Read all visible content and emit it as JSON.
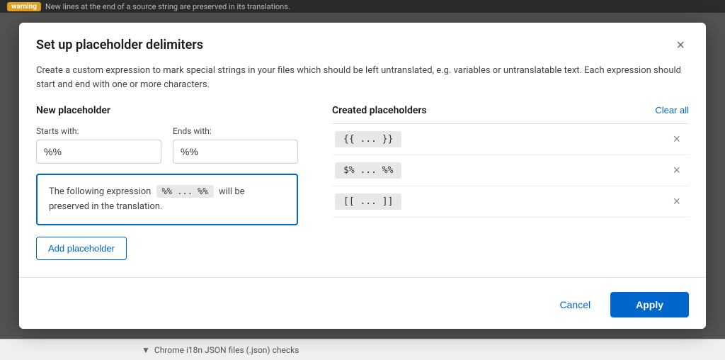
{
  "dialog": {
    "title": "Set up placeholder delimiters",
    "description": "Create a custom expression to mark special strings in your files which should be left untranslated, e.g. variables or untranslatable text. Each expression should start and end with one or more characters.",
    "close_label": "×"
  },
  "left_panel": {
    "section_title": "New placeholder",
    "starts_with_label": "Starts with:",
    "starts_with_value": "%%",
    "ends_with_label": "Ends with:",
    "ends_with_value": "%%",
    "preview_text_before": "The following expression",
    "preview_code": "%% ... %%",
    "preview_text_after": "will be preserved in the translation.",
    "add_button_label": "Add placeholder"
  },
  "right_panel": {
    "section_title": "Created placeholders",
    "clear_all_label": "Clear all",
    "placeholders": [
      {
        "id": 1,
        "tag": "{{ ... }}"
      },
      {
        "id": 2,
        "tag": "$% ... %%"
      },
      {
        "id": 3,
        "tag": "[[ ... ]]"
      }
    ]
  },
  "footer": {
    "cancel_label": "Cancel",
    "apply_label": "Apply"
  },
  "top_bar": {
    "warning_badge": "warning",
    "warning_text": "New lines at the end of a source string are preserved in its translations."
  },
  "bottom_bar": {
    "text": "Chrome i18n JSON files (.json) checks"
  }
}
